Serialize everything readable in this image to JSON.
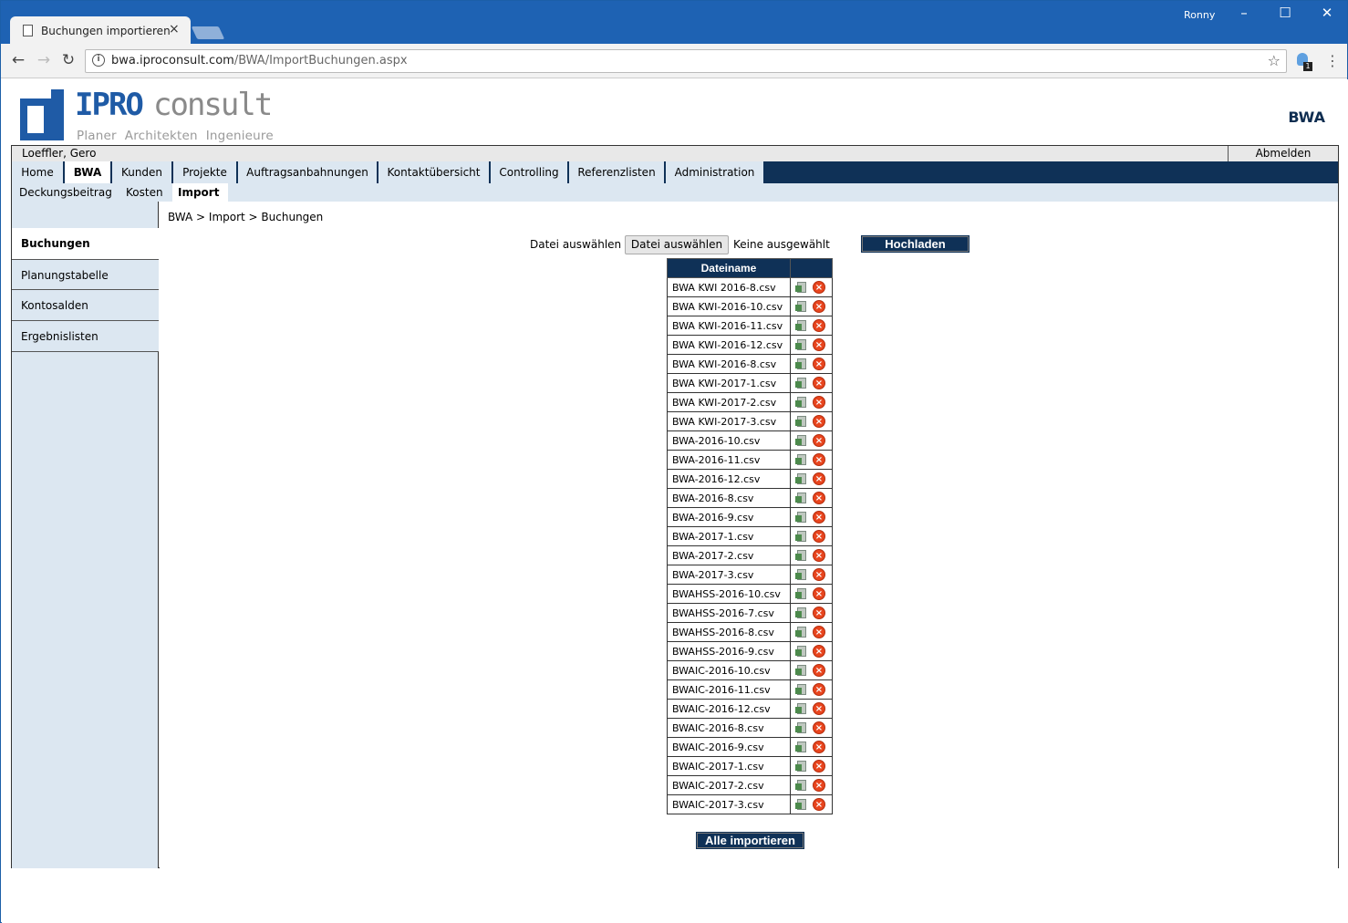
{
  "browser": {
    "tab_title": "Buchungen importieren",
    "tab_close": "×",
    "user": "Ronny",
    "min": "–",
    "max": "☐",
    "close": "✕",
    "back": "←",
    "forward": "→",
    "reload": "↻",
    "url_host": "bwa.iproconsult.com",
    "url_path": "/BWA/ImportBuchungen.aspx",
    "bookmark": "☆",
    "menu": "⋮",
    "ext_badge": "1"
  },
  "brand": {
    "name_primary": "IPRO",
    "name_secondary": "consult",
    "tagline": "Planer  Architekten  Ingenieure",
    "app_title": "BWA"
  },
  "userbar": {
    "user": "Loeffler, Gero",
    "logout": "Abmelden"
  },
  "main_nav": [
    {
      "label": "Home",
      "active": false
    },
    {
      "label": "BWA",
      "active": true
    },
    {
      "label": "Kunden",
      "active": false
    },
    {
      "label": "Projekte",
      "active": false
    },
    {
      "label": "Auftragsanbahnungen",
      "active": false
    },
    {
      "label": "Kontaktübersicht",
      "active": false
    },
    {
      "label": "Controlling",
      "active": false
    },
    {
      "label": "Referenzlisten",
      "active": false
    },
    {
      "label": "Administration",
      "active": false
    }
  ],
  "sub_nav": [
    {
      "label": "Deckungsbeitrag",
      "active": false
    },
    {
      "label": "Kosten",
      "active": false
    },
    {
      "label": "Import",
      "active": true
    }
  ],
  "sidebar": [
    {
      "label": "Buchungen",
      "active": true
    },
    {
      "label": "Planungstabelle",
      "active": false
    },
    {
      "label": "Kontosalden",
      "active": false
    },
    {
      "label": "Ergebnislisten",
      "active": false
    }
  ],
  "breadcrumb": "BWA > Import > Buchungen",
  "upload": {
    "label": "Datei auswählen",
    "file_button": "Datei auswählen",
    "no_file": "Keine ausgewählt",
    "submit": "Hochladen"
  },
  "table": {
    "header": "Dateiname",
    "files": [
      "BWA KWI 2016-8.csv",
      "BWA KWI-2016-10.csv",
      "BWA KWI-2016-11.csv",
      "BWA KWI-2016-12.csv",
      "BWA KWI-2016-8.csv",
      "BWA KWI-2017-1.csv",
      "BWA KWI-2017-2.csv",
      "BWA KWI-2017-3.csv",
      "BWA-2016-10.csv",
      "BWA-2016-11.csv",
      "BWA-2016-12.csv",
      "BWA-2016-8.csv",
      "BWA-2016-9.csv",
      "BWA-2017-1.csv",
      "BWA-2017-2.csv",
      "BWA-2017-3.csv",
      "BWAHSS-2016-10.csv",
      "BWAHSS-2016-7.csv",
      "BWAHSS-2016-8.csv",
      "BWAHSS-2016-9.csv",
      "BWAIC-2016-10.csv",
      "BWAIC-2016-11.csv",
      "BWAIC-2016-12.csv",
      "BWAIC-2016-8.csv",
      "BWAIC-2016-9.csv",
      "BWAIC-2017-1.csv",
      "BWAIC-2017-2.csv",
      "BWAIC-2017-3.csv"
    ],
    "delete_glyph": "×"
  },
  "import_all": "Alle importieren",
  "colors": {
    "navy": "#0f3157",
    "brand_blue": "#1f5ba6",
    "light_blue": "#dce7f1",
    "chrome_blue": "#1e62b3",
    "delete_red": "#e8451e"
  }
}
